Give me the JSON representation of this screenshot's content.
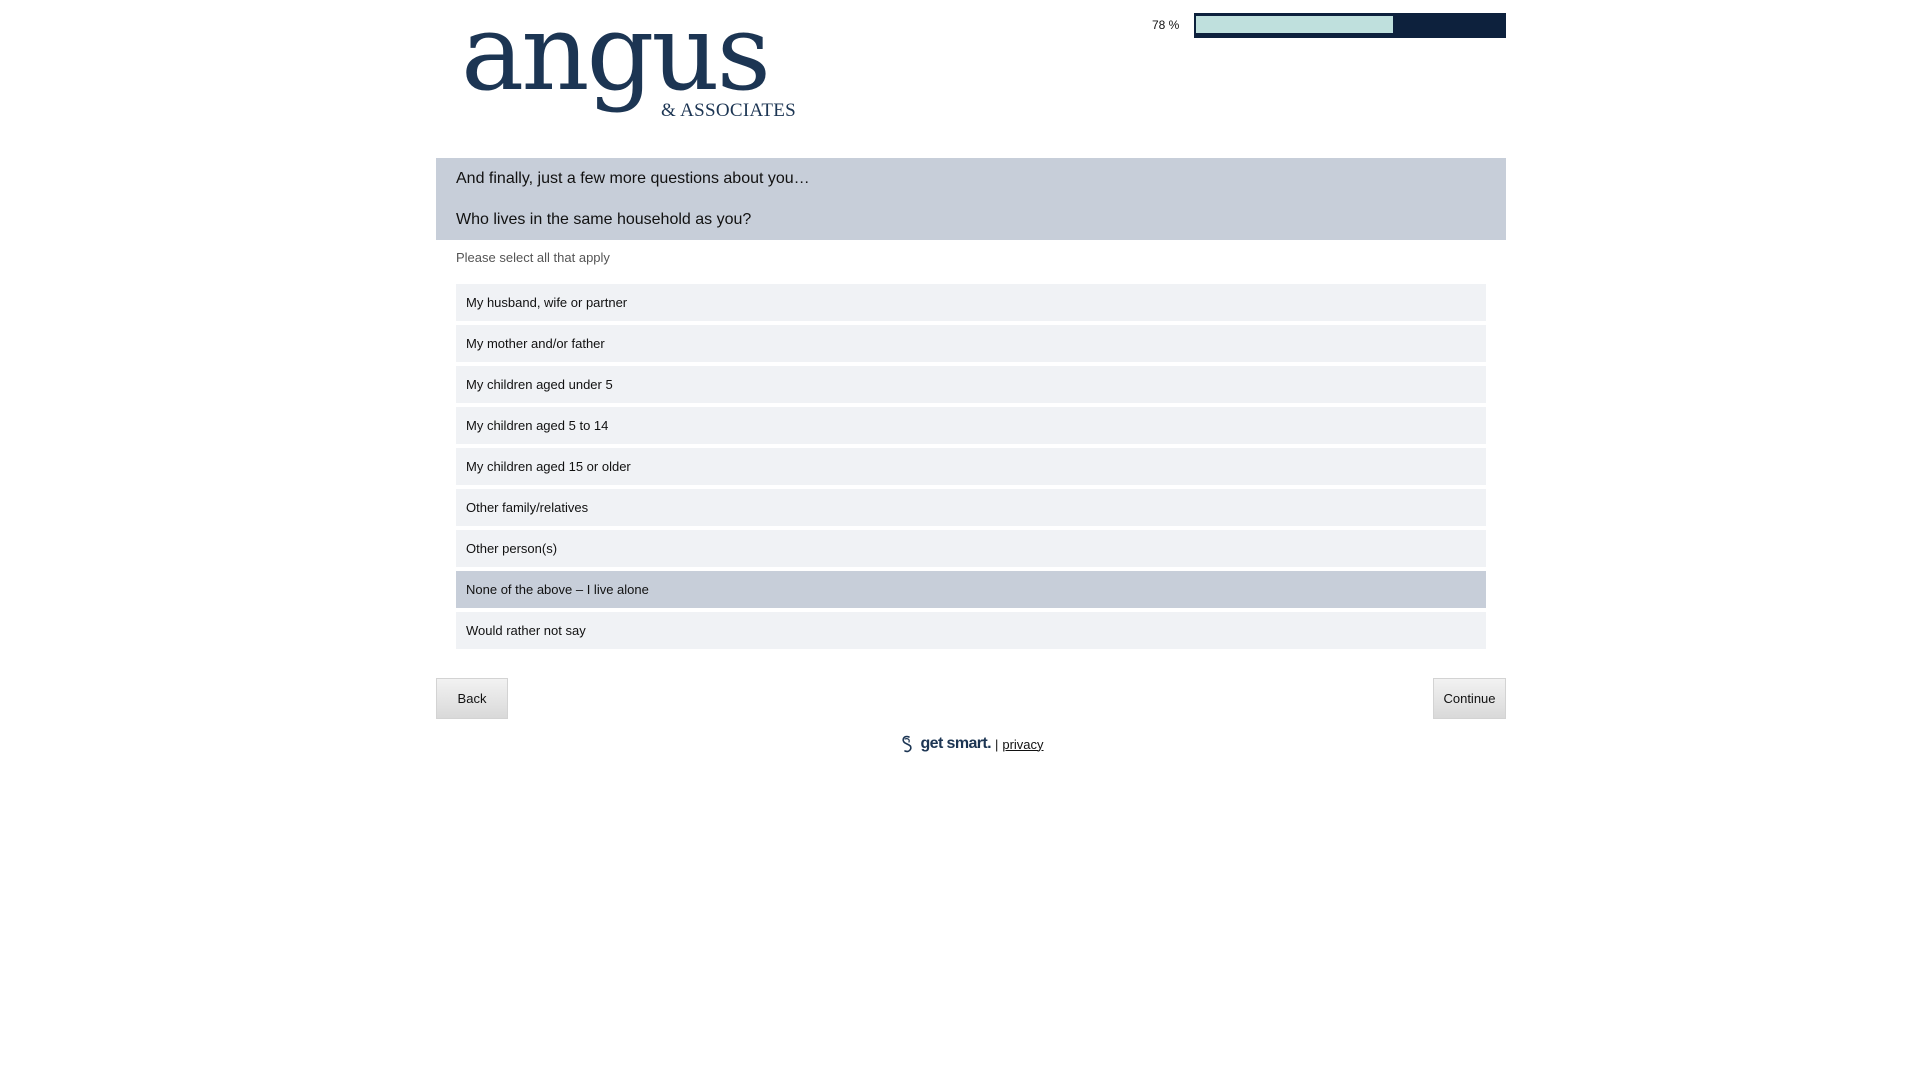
{
  "brand": {
    "logo_word": "angus",
    "logo_sub": "& ASSOCIATES",
    "color": "#1c3553"
  },
  "progress": {
    "label": "78 %",
    "value": 0.78,
    "fill_color": "#bfe0dd",
    "track_color": "#0d213d"
  },
  "question": {
    "intro": "And finally, just a few more questions about you…",
    "text": "Who lives in the same household as you?",
    "instruction": "Please select all that apply"
  },
  "options": [
    {
      "label": "My husband, wife or partner",
      "selected": false
    },
    {
      "label": "My mother and/or father",
      "selected": false
    },
    {
      "label": "My children aged under 5",
      "selected": false
    },
    {
      "label": "My children aged 5 to 14",
      "selected": false
    },
    {
      "label": "My children aged 15 or older",
      "selected": false
    },
    {
      "label": "Other family/relatives",
      "selected": false
    },
    {
      "label": "Other person(s)",
      "selected": false
    },
    {
      "label": "None of the above – I live alone",
      "selected": true
    },
    {
      "label": "Would rather not say",
      "selected": false
    }
  ],
  "nav": {
    "back_label": "Back",
    "continue_label": "Continue"
  },
  "footer": {
    "brand": "get smart.",
    "separator": "|",
    "privacy_label": "privacy"
  },
  "colors": {
    "question_bg": "#c7ced9",
    "option_bg": "#f0f2f5",
    "option_selected_bg": "#c7ced9"
  }
}
